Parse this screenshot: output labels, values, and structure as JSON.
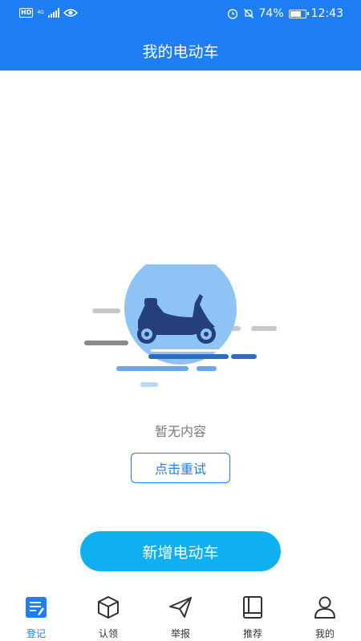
{
  "status_bar": {
    "hd": "HD",
    "net": "4G",
    "battery": "74%",
    "battery_level": 0.74,
    "time": "12:43",
    "icons": [
      "signal-icon",
      "eye-icon",
      "alarm-icon",
      "mute-icon",
      "battery-icon"
    ]
  },
  "header": {
    "title": "我的电动车"
  },
  "empty_state": {
    "message": "暂无内容",
    "retry_label": "点击重试",
    "illustration": "scooter-icon"
  },
  "add_button_label": "新增电动车",
  "colors": {
    "primary": "#1e7ef6",
    "accent": "#0eb0f2",
    "scooter": "#243f7a",
    "circle": "#8ec3f5"
  },
  "bottom_nav": {
    "items": [
      {
        "label": "登记",
        "icon": "register-icon",
        "active": true
      },
      {
        "label": "认领",
        "icon": "box-icon",
        "active": false
      },
      {
        "label": "举报",
        "icon": "send-icon",
        "active": false
      },
      {
        "label": "推荐",
        "icon": "book-icon",
        "active": false
      },
      {
        "label": "我的",
        "icon": "user-icon",
        "active": false
      }
    ]
  }
}
